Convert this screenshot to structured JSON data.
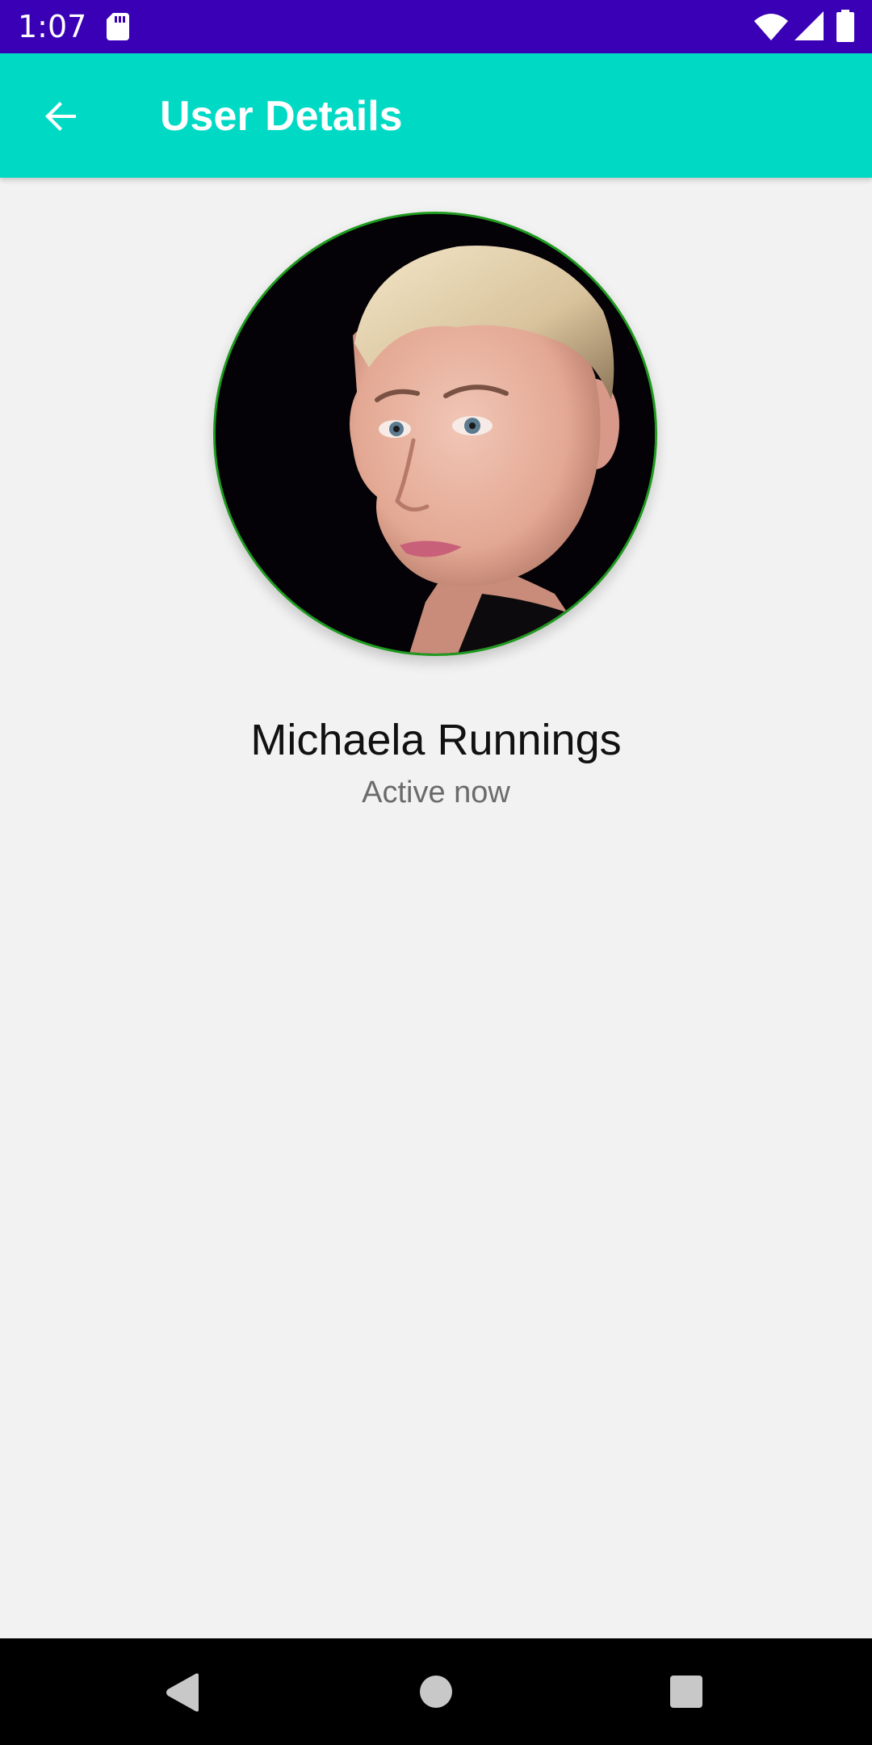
{
  "status_bar": {
    "time": "1:07",
    "icons": [
      "sd-card-icon",
      "wifi-icon",
      "cell-signal-icon",
      "battery-icon"
    ],
    "background_color": "#3a00b6"
  },
  "toolbar": {
    "title": "User Details",
    "back_icon": "arrow-back-icon",
    "background_color": "#00dac5"
  },
  "profile": {
    "name": "Michaela Runnings",
    "status": "Active now",
    "avatar_border_color": "#1e9a1e"
  },
  "nav_bar": {
    "icons": [
      "nav-back-icon",
      "nav-home-icon",
      "nav-recents-icon"
    ]
  }
}
